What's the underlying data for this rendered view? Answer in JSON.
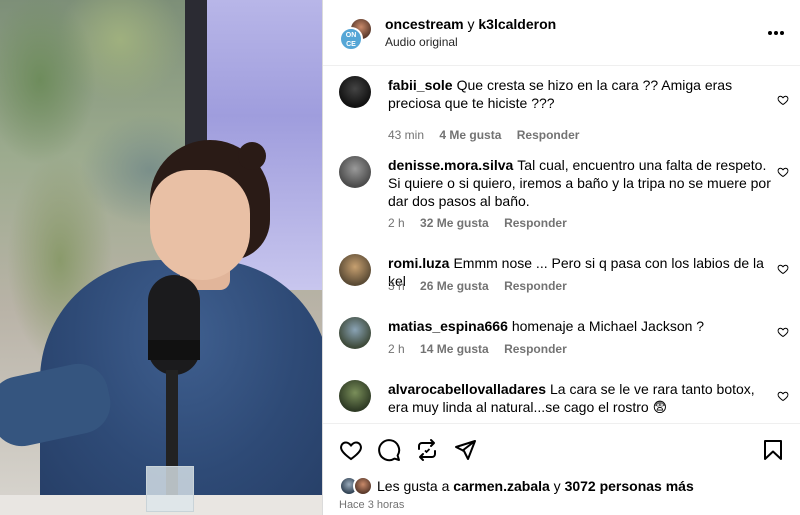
{
  "post": {
    "author_primary": "oncestream",
    "author_connector": "y",
    "author_secondary": "k3lcalderon",
    "audio": "Audio original",
    "more_icon": "more-horizontal-icon",
    "brand_badge_text": "ON CE"
  },
  "comments": [
    {
      "user": "fabii_sole",
      "text": "Que cresta se hizo en la cara ?? Amiga eras preciosa que te hiciste ???",
      "time": "43 min",
      "likes": "4 Me gusta",
      "reply": "Responder"
    },
    {
      "user": "denisse.mora.silva",
      "text": "Tal cual, encuentro una falta de respeto. Si quiere o si quiero, iremos a baño y la tripa no se muere por dar dos pasos al baño.",
      "time": "2 h",
      "likes": "32 Me gusta",
      "reply": "Responder"
    },
    {
      "user": "romi.luza",
      "text": "Emmm nose ... Pero si q pasa con los labios de la kel",
      "time": "3 h",
      "likes": "26 Me gusta",
      "reply": "Responder"
    },
    {
      "user": "matias_espina666",
      "text": "homenaje a Michael Jackson ?",
      "time": "2 h",
      "likes": "14 Me gusta",
      "reply": "Responder"
    },
    {
      "user": "alvarocabellovalladares",
      "text": "La cara se le ve rara tanto botox, era muy linda al natural...se cago el rostro 😨",
      "time": "",
      "likes": "",
      "reply": ""
    }
  ],
  "footer": {
    "likes_prefix": "Les gusta a",
    "likes_user": "carmen.zabala",
    "likes_connector": "y",
    "likes_others": "3072 personas más",
    "time_ago": "Hace 3 horas"
  },
  "icons": {
    "like": "heart-icon",
    "comment": "comment-icon",
    "share": "repost-icon",
    "send": "send-icon",
    "save": "bookmark-icon"
  },
  "colors": {
    "meta_gray": "#737373",
    "brand_blue": "#55a6d6"
  }
}
